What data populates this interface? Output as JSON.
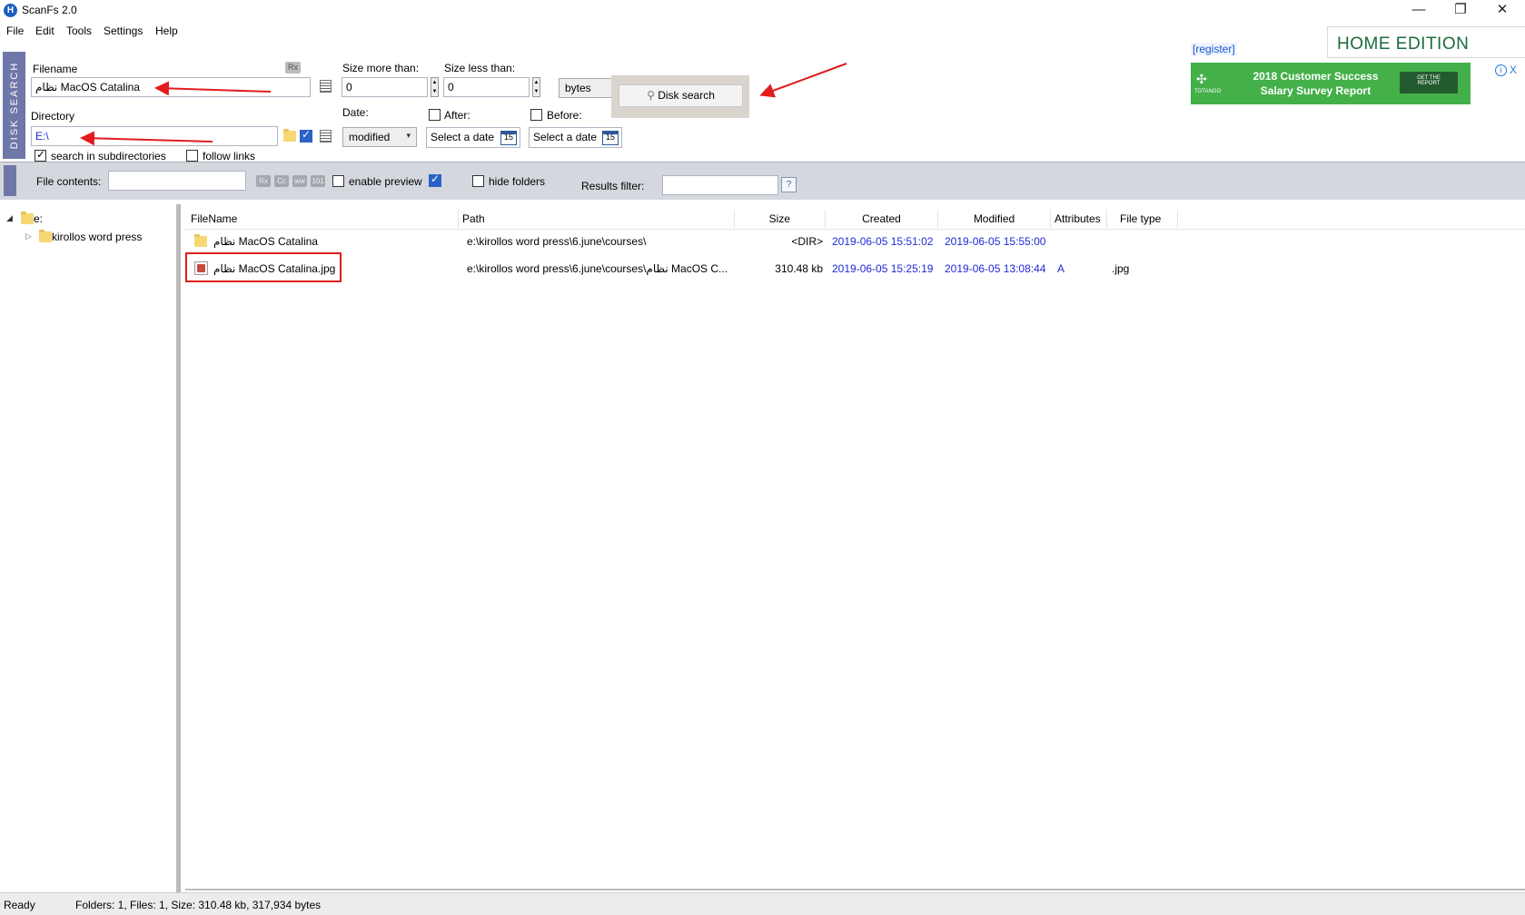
{
  "window": {
    "title": "ScanFs 2.0",
    "icon": "scanfs-app-icon",
    "controls": [
      "minimize-icon",
      "restore-icon",
      "close-icon"
    ]
  },
  "menu": [
    "File",
    "Edit",
    "Tools",
    "Settings",
    "Help"
  ],
  "disk_search_tab": "DISK SEARCH",
  "filename": {
    "label": "Filename",
    "value": "نظام MacOS Catalina",
    "rx": "Rx"
  },
  "directory": {
    "label": "Directory",
    "value": "E:\\"
  },
  "options": {
    "subdirs_label": "search in subdirectories",
    "subdirs_checked": true,
    "follow_links_label": "follow links",
    "follow_links_checked": false
  },
  "size": {
    "more_label": "Size more than:",
    "more_value": "0",
    "less_label": "Size less than:",
    "less_value": "0",
    "unit": "bytes"
  },
  "date": {
    "label": "Date:",
    "mode": "modified",
    "after_label": "After:",
    "after_checked": false,
    "after_value": "Select a date",
    "before_label": "Before:",
    "before_checked": false,
    "before_value": "Select a date",
    "calendar_day": "15"
  },
  "search_button": "Disk search",
  "register_link": "[register]",
  "edition": "HOME EDITION",
  "ad": {
    "line1": "2018 Customer Success",
    "line2": "Salary Survey Report",
    "brand": "TOTANGO",
    "cta_line1": "GET THE",
    "cta_line2": "REPORT",
    "info": "i",
    "close": "X"
  },
  "toolbar2": {
    "file_contents_label": "File contents:",
    "file_contents_value": "",
    "icons": [
      "Rx",
      "Cc",
      "ww",
      "101"
    ],
    "enable_preview_label": "enable preview",
    "enable_preview_checked": false,
    "hide_folders_label": "hide folders",
    "hide_folders_checked": false,
    "results_filter_label": "Results filter:",
    "results_filter_value": "",
    "help": "?"
  },
  "tree": {
    "root": "e:",
    "children": [
      "kirollos word press"
    ]
  },
  "columns": [
    "FileName",
    "Path",
    "Size",
    "Created",
    "Modified",
    "Attributes",
    "File type"
  ],
  "results": [
    {
      "name": "نظام MacOS Catalina",
      "path": "e:\\kirollos word press\\6.june\\courses\\",
      "size": "<DIR>",
      "created": "2019-06-05 15:51:02",
      "modified": "2019-06-05 15:55:00",
      "attributes": "",
      "type": "",
      "icon": "folder-icon"
    },
    {
      "name": "نظام MacOS Catalina.jpg",
      "path": "e:\\kirollos word press\\6.june\\courses\\نظام MacOS C...",
      "size": "310.48 kb",
      "created": "2019-06-05 15:25:19",
      "modified": "2019-06-05 13:08:44",
      "attributes": "A",
      "type": ".jpg",
      "icon": "image-file-icon"
    }
  ],
  "status": {
    "state": "Ready",
    "summary": "Folders: 1, Files: 1, Size: 310.48 kb, 317,934 bytes"
  },
  "colors": {
    "accent_tab": "#6f76a8",
    "date_text": "#1f2ad6",
    "annotation_red": "#e21c1c",
    "edition_green": "#1b6a3e",
    "ad_green": "#44b049"
  }
}
